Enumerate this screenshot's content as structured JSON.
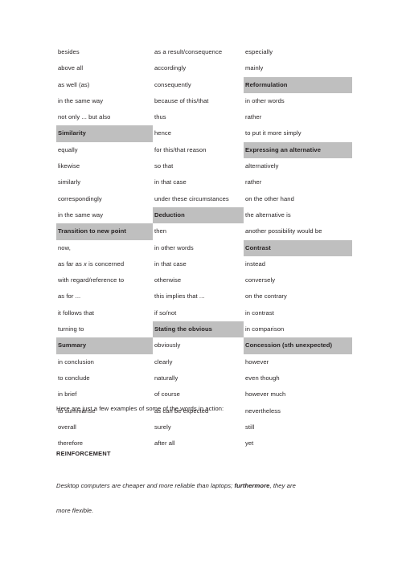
{
  "document": {
    "table": {
      "columns": 3,
      "rows": [
        [
          {
            "text": "besides",
            "style": "plain"
          },
          {
            "text": "as a result/consequence",
            "style": "plain"
          },
          {
            "text": "especially",
            "style": "plain"
          }
        ],
        [
          {
            "text": "above all",
            "style": "plain"
          },
          {
            "text": "accordingly",
            "style": "plain"
          },
          {
            "text": "mainly",
            "style": "plain"
          }
        ],
        [
          {
            "text": "as well (as)",
            "style": "plain"
          },
          {
            "text": "consequently",
            "style": "plain"
          },
          {
            "text": "Reformulation",
            "style": "header"
          }
        ],
        [
          {
            "text": "in the same way",
            "style": "plain"
          },
          {
            "text": "because of this/that",
            "style": "plain"
          },
          {
            "text": "in other words",
            "style": "plain"
          }
        ],
        [
          {
            "text": "not only ... but also",
            "style": "plain"
          },
          {
            "text": "thus",
            "style": "plain"
          },
          {
            "text": "rather",
            "style": "plain"
          }
        ],
        [
          {
            "text": "Similarity",
            "style": "header"
          },
          {
            "text": "hence",
            "style": "plain"
          },
          {
            "text": "to put it more simply",
            "style": "plain"
          }
        ],
        [
          {
            "text": "equally",
            "style": "plain"
          },
          {
            "text": "for this/that reason",
            "style": "plain"
          },
          {
            "text": "Expressing an alternative",
            "style": "header"
          }
        ],
        [
          {
            "text": "likewise",
            "style": "plain"
          },
          {
            "text": "so that",
            "style": "plain"
          },
          {
            "text": "alternatively",
            "style": "plain"
          }
        ],
        [
          {
            "text": "similarly",
            "style": "plain"
          },
          {
            "text": "in that case",
            "style": "plain"
          },
          {
            "text": "rather",
            "style": "plain"
          }
        ],
        [
          {
            "text": "correspondingly",
            "style": "plain"
          },
          {
            "text": "under these circumstances",
            "style": "plain"
          },
          {
            "text": "on the other hand",
            "style": "plain"
          }
        ],
        [
          {
            "text": "in the same way",
            "style": "plain"
          },
          {
            "text": "Deduction",
            "style": "header"
          },
          {
            "text": "the alternative is",
            "style": "plain"
          }
        ],
        [
          {
            "text": "Transition to new point",
            "style": "header"
          },
          {
            "text": "then",
            "style": "plain"
          },
          {
            "text": "another possibility would be",
            "style": "plain"
          }
        ],
        [
          {
            "text": "now,",
            "style": "plain"
          },
          {
            "text": "in other words",
            "style": "plain"
          },
          {
            "text": "Contrast",
            "style": "header"
          }
        ],
        [
          {
            "text": "as far as x is concerned",
            "style": "plain",
            "italic_word": "x"
          },
          {
            "text": "in that case",
            "style": "plain"
          },
          {
            "text": "instead",
            "style": "plain"
          }
        ],
        [
          {
            "text": "with regard/reference to",
            "style": "plain"
          },
          {
            "text": "otherwise",
            "style": "plain"
          },
          {
            "text": "conversely",
            "style": "plain"
          }
        ],
        [
          {
            "text": "as for ...",
            "style": "plain"
          },
          {
            "text": "this implies that ...",
            "style": "plain"
          },
          {
            "text": "on the contrary",
            "style": "plain"
          }
        ],
        [
          {
            "text": "it follows that",
            "style": "plain"
          },
          {
            "text": "if so/not",
            "style": "plain"
          },
          {
            "text": "in contrast",
            "style": "plain"
          }
        ],
        [
          {
            "text": "turning to",
            "style": "plain"
          },
          {
            "text": "Stating the obvious",
            "style": "header"
          },
          {
            "text": "in comparison",
            "style": "plain"
          }
        ],
        [
          {
            "text": "Summary",
            "style": "header"
          },
          {
            "text": "obviously",
            "style": "plain"
          },
          {
            "text": "Concession (sth unexpected)",
            "style": "header"
          }
        ],
        [
          {
            "text": "in conclusion",
            "style": "plain"
          },
          {
            "text": "clearly",
            "style": "plain"
          },
          {
            "text": "however",
            "style": "plain"
          }
        ],
        [
          {
            "text": "to conclude",
            "style": "plain"
          },
          {
            "text": "naturally",
            "style": "plain"
          },
          {
            "text": "even though",
            "style": "plain"
          }
        ],
        [
          {
            "text": "in brief",
            "style": "plain"
          },
          {
            "text": "of course",
            "style": "plain"
          },
          {
            "text": "however much",
            "style": "plain"
          }
        ],
        [
          {
            "text": "to summarise",
            "style": "plain"
          },
          {
            "text": "as can be expected",
            "style": "plain"
          },
          {
            "text": "nevertheless",
            "style": "plain"
          }
        ],
        [
          {
            "text": "overall",
            "style": "plain"
          },
          {
            "text": "surely",
            "style": "plain"
          },
          {
            "text": "still",
            "style": "plain"
          }
        ],
        [
          {
            "text": "therefore",
            "style": "plain"
          },
          {
            "text": "after all",
            "style": "plain"
          },
          {
            "text": "yet",
            "style": "plain"
          }
        ]
      ]
    },
    "intro_line": "Here are just a few examples of some of the words in action:",
    "section_heading": "REINFORCEMENT",
    "example": {
      "line1_before": "Desktop computers are cheaper and more reliable than laptops; ",
      "line1_bold": "furthermore",
      "line1_after": ", they are",
      "line2": "more flexible."
    },
    "colors": {
      "highlight": "#bfbfbf",
      "text": "#231f20",
      "page_background": "#ffffff"
    }
  }
}
